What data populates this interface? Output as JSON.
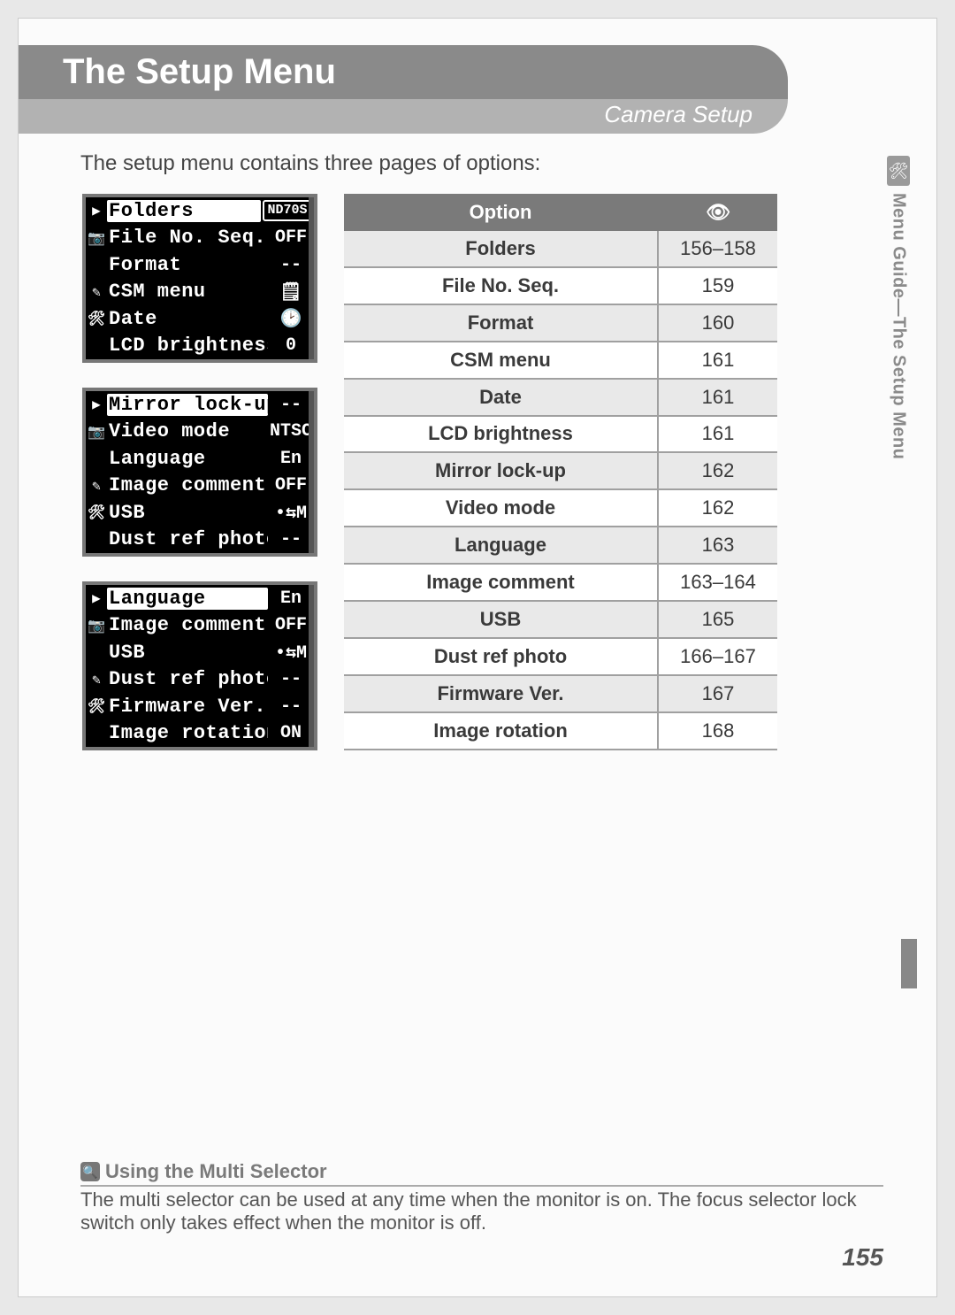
{
  "header": {
    "title": "The Setup Menu",
    "subtitle": "Camera Setup"
  },
  "intro": "The setup menu contains three pages of options:",
  "side_tab": {
    "icon": "🛠",
    "text": "Menu Guide—The Setup Menu"
  },
  "lcd_screens": [
    {
      "rows": [
        {
          "icon": "▶",
          "label": "Folders",
          "value": "ND70S",
          "highlight": true,
          "boxval": true
        },
        {
          "icon": "📷",
          "label": "File No. Seq.",
          "value": "OFF"
        },
        {
          "icon": "",
          "label": "Format",
          "value": "--"
        },
        {
          "icon": "✎",
          "label": "CSM menu",
          "value": "🗒"
        },
        {
          "icon": "🛠",
          "label": "Date",
          "value": "🕑"
        },
        {
          "icon": "",
          "label": "LCD brightness",
          "value": "0"
        }
      ]
    },
    {
      "rows": [
        {
          "icon": "▶",
          "label": "Mirror lock-up",
          "value": "--",
          "highlight": true
        },
        {
          "icon": "📷",
          "label": "Video mode",
          "value": "NTSC",
          "boxval": true
        },
        {
          "icon": "",
          "label": "Language",
          "value": "En"
        },
        {
          "icon": "✎",
          "label": "Image comment",
          "value": "OFF"
        },
        {
          "icon": "🛠",
          "label": "USB",
          "value": "•⇆M"
        },
        {
          "icon": "",
          "label": "Dust ref photo",
          "value": "--"
        }
      ]
    },
    {
      "rows": [
        {
          "icon": "▶",
          "label": "Language",
          "value": "En",
          "highlight": true
        },
        {
          "icon": "📷",
          "label": "Image comment",
          "value": "OFF"
        },
        {
          "icon": "",
          "label": "USB",
          "value": "•⇆M"
        },
        {
          "icon": "✎",
          "label": "Dust ref photo",
          "value": "--"
        },
        {
          "icon": "🛠",
          "label": "Firmware Ver.",
          "value": "--"
        },
        {
          "icon": "",
          "label": "Image rotation",
          "value": "ON"
        }
      ]
    }
  ],
  "options_table": {
    "head_option": "Option",
    "head_page_icon": "👁",
    "rows": [
      {
        "option": "Folders",
        "pages": "156–158"
      },
      {
        "option": "File No. Seq.",
        "pages": "159"
      },
      {
        "option": "Format",
        "pages": "160"
      },
      {
        "option": "CSM menu",
        "pages": "161"
      },
      {
        "option": "Date",
        "pages": "161"
      },
      {
        "option": "LCD brightness",
        "pages": "161"
      },
      {
        "option": "Mirror lock-up",
        "pages": "162"
      },
      {
        "option": "Video mode",
        "pages": "162"
      },
      {
        "option": "Language",
        "pages": "163"
      },
      {
        "option": "Image comment",
        "pages": "163–164"
      },
      {
        "option": "USB",
        "pages": "165"
      },
      {
        "option": "Dust ref photo",
        "pages": "166–167"
      },
      {
        "option": "Firmware Ver.",
        "pages": "167"
      },
      {
        "option": "Image rotation",
        "pages": "168"
      }
    ]
  },
  "note": {
    "icon": "🔍",
    "heading": "Using the Multi Selector",
    "body": "The multi selector can be used at any time when the monitor is on.  The focus selector lock switch only takes effect when the monitor is off."
  },
  "page_number": "155"
}
